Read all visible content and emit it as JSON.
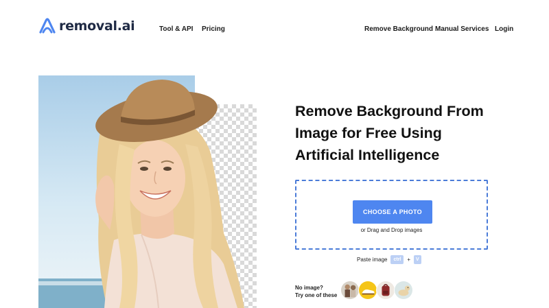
{
  "brand": {
    "name": "removal.ai",
    "logo_color": "#4e86f0"
  },
  "nav": {
    "tool_api": "Tool & API",
    "pricing": "Pricing",
    "remove_background": "Remove Background",
    "manual_services": "Manual Services",
    "login": "Login"
  },
  "hero": {
    "headline_line1": "Remove Background From",
    "headline_line2": "Image for Free Using",
    "headline_line3": "Artificial Intelligence"
  },
  "upload": {
    "button_label": "CHOOSE A PHOTO",
    "drag_text": "or Drag and Drop images",
    "paste_label": "Paste image",
    "key_ctrl": "ctrl",
    "key_plus": "+",
    "key_v": "V",
    "accent_color": "#4e86f0"
  },
  "samples": {
    "label_line1": "No image?",
    "label_line2": "Try one of these",
    "items": [
      "sample-people",
      "sample-shoe",
      "sample-backpack",
      "sample-dog"
    ]
  }
}
